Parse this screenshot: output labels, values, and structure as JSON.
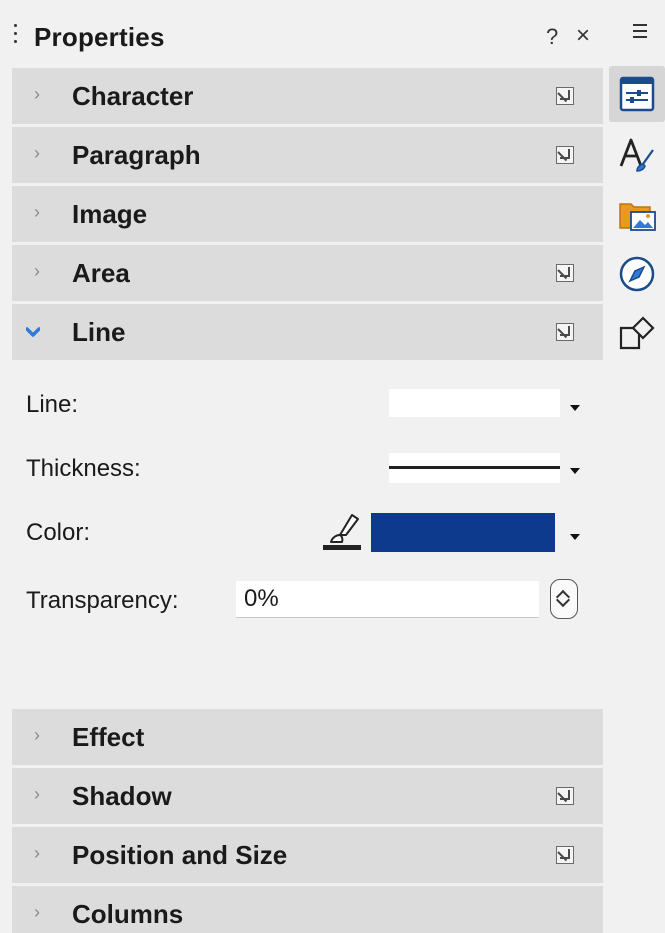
{
  "panel": {
    "title": "Properties",
    "help_label": "?",
    "close_label": "×"
  },
  "sections": [
    {
      "label": "Character",
      "expanded": false,
      "has_more_options": true
    },
    {
      "label": "Paragraph",
      "expanded": false,
      "has_more_options": true
    },
    {
      "label": "Image",
      "expanded": false,
      "has_more_options": false
    },
    {
      "label": "Area",
      "expanded": false,
      "has_more_options": true
    },
    {
      "label": "Line",
      "expanded": true,
      "has_more_options": true
    },
    {
      "label": "Effect",
      "expanded": false,
      "has_more_options": false
    },
    {
      "label": "Shadow",
      "expanded": false,
      "has_more_options": true
    },
    {
      "label": "Position and Size",
      "expanded": false,
      "has_more_options": true
    },
    {
      "label": "Columns",
      "expanded": false,
      "has_more_options": false
    }
  ],
  "line_panel": {
    "line_label": "Line:",
    "thickness_label": "Thickness:",
    "color_label": "Color:",
    "color_value": "#0d3a8c",
    "transparency_label": "Transparency:",
    "transparency_value": "0%"
  },
  "icons": {
    "collapsed_chevron": "chevron-right-icon",
    "expanded_chevron": "chevron-down-icon",
    "more_options": "more-options-icon"
  },
  "rail": {
    "menu_icon": "hamburger-menu-icon",
    "tabs": [
      "properties-icon",
      "styles-icon",
      "gallery-icon",
      "navigator-icon",
      "shapes-icon"
    ],
    "active_tab": "properties-icon"
  },
  "colors": {
    "section_header_bg": "#dcdcdc",
    "panel_bg": "#f1f1f1",
    "accent_blue": "#2f7bd7"
  }
}
